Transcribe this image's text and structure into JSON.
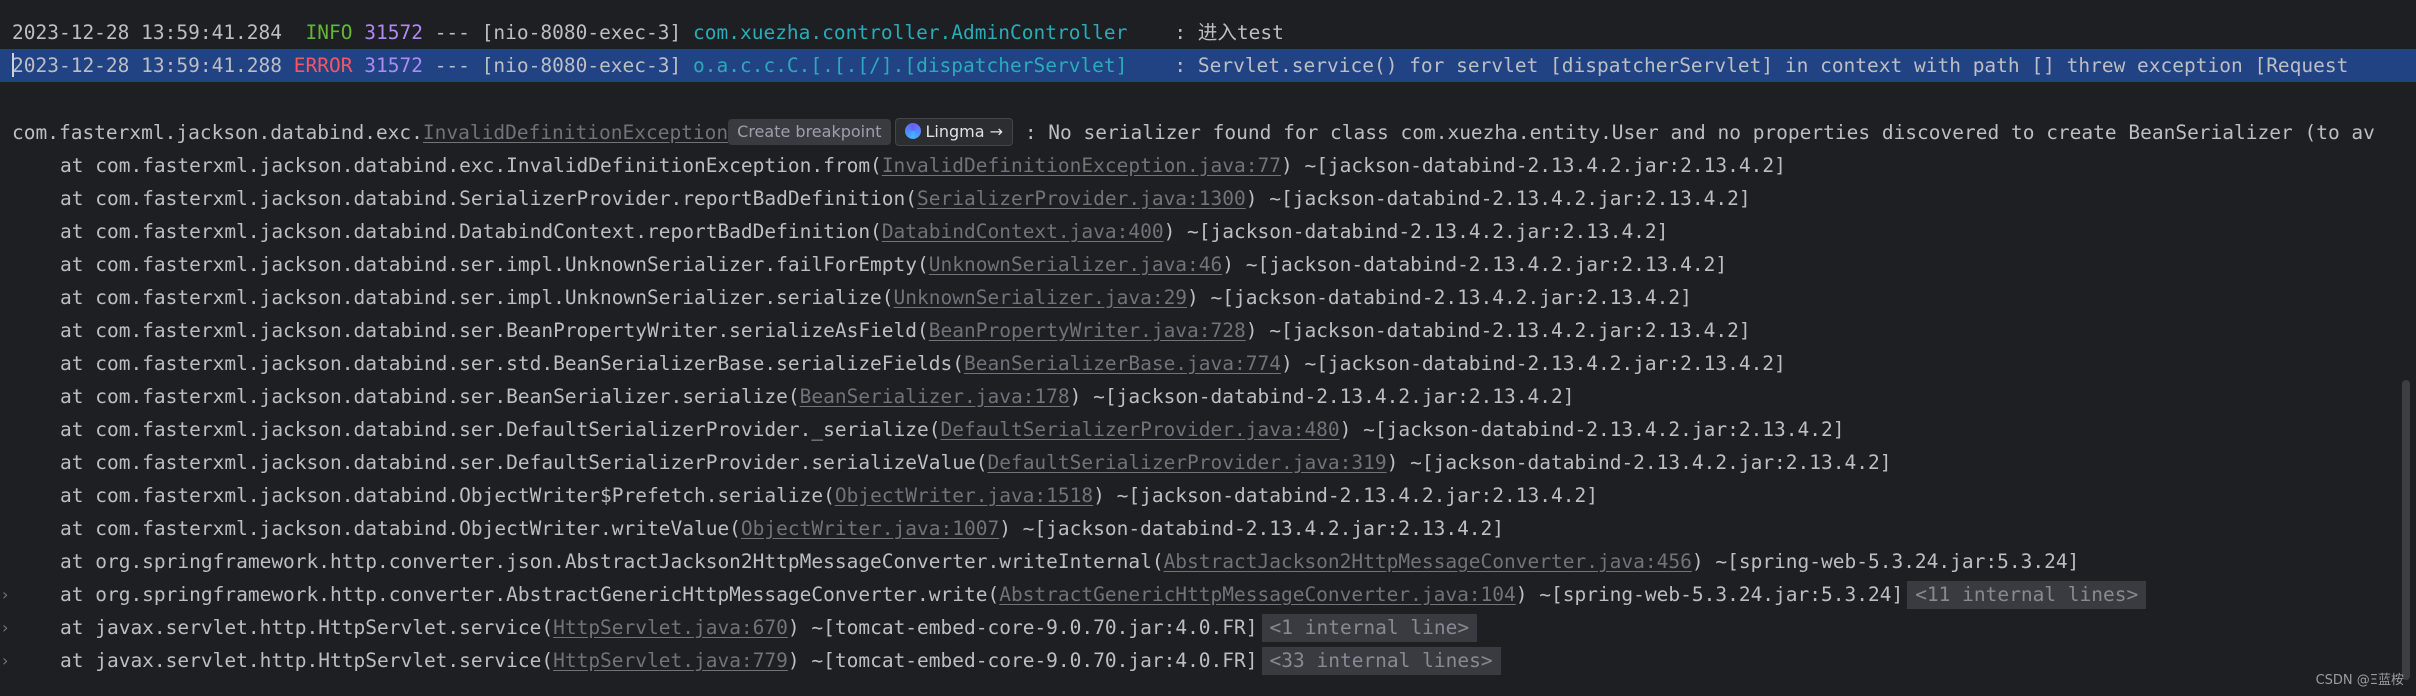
{
  "log_lines": [
    {
      "timestamp": "2023-12-28 13:59:41.284",
      "level": "INFO",
      "pid": "31572",
      "sep": "---",
      "thread": "[nio-8080-exec-3]",
      "logger": "com.xuezha.controller.AdminController",
      "message": ": 进入test"
    },
    {
      "timestamp": "2023-12-28 13:59:41.288",
      "level": "ERROR",
      "pid": "31572",
      "sep": "---",
      "thread": "[nio-8080-exec-3]",
      "logger": "o.a.c.c.C.[.[.[/].[dispatcherServlet]",
      "message": ": Servlet.service() for servlet [dispatcherServlet] in context with path [] threw exception [Request"
    }
  ],
  "exception": {
    "package": "com.fasterxml.jackson.databind.exc.",
    "class_link": "InvalidDefinitionException",
    "create_breakpoint": "Create breakpoint",
    "lingma_label": "Lingma →",
    "message": ": No serializer found for class com.xuezha.entity.User and no properties discovered to create BeanSerializer (to av"
  },
  "stack_frames": [
    {
      "method": "at com.fasterxml.jackson.databind.exc.InvalidDefinitionException.from(",
      "link": "InvalidDefinitionException.java:77",
      "suffix": ") ~[jackson-databind-2.13.4.2.jar:2.13.4.2]",
      "fold": "",
      "expandable": false
    },
    {
      "method": "at com.fasterxml.jackson.databind.SerializerProvider.reportBadDefinition(",
      "link": "SerializerProvider.java:1300",
      "suffix": ") ~[jackson-databind-2.13.4.2.jar:2.13.4.2]",
      "fold": "",
      "expandable": false
    },
    {
      "method": "at com.fasterxml.jackson.databind.DatabindContext.reportBadDefinition(",
      "link": "DatabindContext.java:400",
      "suffix": ") ~[jackson-databind-2.13.4.2.jar:2.13.4.2]",
      "fold": "",
      "expandable": false
    },
    {
      "method": "at com.fasterxml.jackson.databind.ser.impl.UnknownSerializer.failForEmpty(",
      "link": "UnknownSerializer.java:46",
      "suffix": ") ~[jackson-databind-2.13.4.2.jar:2.13.4.2]",
      "fold": "",
      "expandable": false
    },
    {
      "method": "at com.fasterxml.jackson.databind.ser.impl.UnknownSerializer.serialize(",
      "link": "UnknownSerializer.java:29",
      "suffix": ") ~[jackson-databind-2.13.4.2.jar:2.13.4.2]",
      "fold": "",
      "expandable": false
    },
    {
      "method": "at com.fasterxml.jackson.databind.ser.BeanPropertyWriter.serializeAsField(",
      "link": "BeanPropertyWriter.java:728",
      "suffix": ") ~[jackson-databind-2.13.4.2.jar:2.13.4.2]",
      "fold": "",
      "expandable": false
    },
    {
      "method": "at com.fasterxml.jackson.databind.ser.std.BeanSerializerBase.serializeFields(",
      "link": "BeanSerializerBase.java:774",
      "suffix": ") ~[jackson-databind-2.13.4.2.jar:2.13.4.2]",
      "fold": "",
      "expandable": false
    },
    {
      "method": "at com.fasterxml.jackson.databind.ser.BeanSerializer.serialize(",
      "link": "BeanSerializer.java:178",
      "suffix": ") ~[jackson-databind-2.13.4.2.jar:2.13.4.2]",
      "fold": "",
      "expandable": false
    },
    {
      "method": "at com.fasterxml.jackson.databind.ser.DefaultSerializerProvider._serialize(",
      "link": "DefaultSerializerProvider.java:480",
      "suffix": ") ~[jackson-databind-2.13.4.2.jar:2.13.4.2]",
      "fold": "",
      "expandable": false
    },
    {
      "method": "at com.fasterxml.jackson.databind.ser.DefaultSerializerProvider.serializeValue(",
      "link": "DefaultSerializerProvider.java:319",
      "suffix": ") ~[jackson-databind-2.13.4.2.jar:2.13.4.2]",
      "fold": "",
      "expandable": false
    },
    {
      "method": "at com.fasterxml.jackson.databind.ObjectWriter$Prefetch.serialize(",
      "link": "ObjectWriter.java:1518",
      "suffix": ") ~[jackson-databind-2.13.4.2.jar:2.13.4.2]",
      "fold": "",
      "expandable": false
    },
    {
      "method": "at com.fasterxml.jackson.databind.ObjectWriter.writeValue(",
      "link": "ObjectWriter.java:1007",
      "suffix": ") ~[jackson-databind-2.13.4.2.jar:2.13.4.2]",
      "fold": "",
      "expandable": false
    },
    {
      "method": "at org.springframework.http.converter.json.AbstractJackson2HttpMessageConverter.writeInternal(",
      "link": "AbstractJackson2HttpMessageConverter.java:456",
      "suffix": ") ~[spring-web-5.3.24.jar:5.3.24]",
      "fold": "",
      "expandable": false
    },
    {
      "method": "at org.springframework.http.converter.AbstractGenericHttpMessageConverter.write(",
      "link": "AbstractGenericHttpMessageConverter.java:104",
      "suffix": ") ~[spring-web-5.3.24.jar:5.3.24]",
      "fold": "<11 internal lines>",
      "expandable": true
    },
    {
      "method": "at javax.servlet.http.HttpServlet.service(",
      "link": "HttpServlet.java:670",
      "suffix": ") ~[tomcat-embed-core-9.0.70.jar:4.0.FR]",
      "fold": "<1 internal line>",
      "expandable": true
    },
    {
      "method": "at javax.servlet.http.HttpServlet.service(",
      "link": "HttpServlet.java:779",
      "suffix": ") ~[tomcat-embed-core-9.0.70.jar:4.0.FR]",
      "fold": "<33 internal lines>",
      "expandable": true
    }
  ],
  "icons": {
    "expand": "chevron-right-icon",
    "lingma": "lingma-logo-icon"
  },
  "colors": {
    "background": "#1e1f22",
    "selection": "#214283",
    "info": "#5fb832",
    "error": "#f75464",
    "pid": "#b189f5",
    "logger": "#2aacb8",
    "link": "#6f737a"
  },
  "watermark": "CSDN @Ξ蓝桉"
}
